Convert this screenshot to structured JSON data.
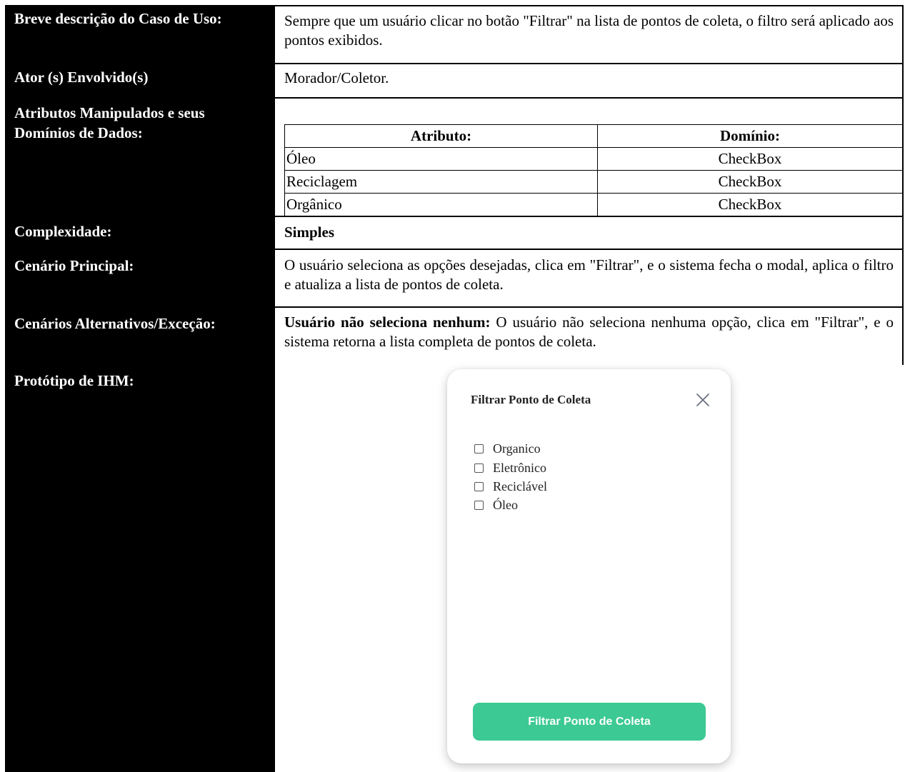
{
  "labels": {
    "description": "Breve descrição do Caso de Uso:",
    "actors": "Ator (s) Envolvido(s)",
    "attributes": "Atributos Manipulados e seus Domínios de Dados:",
    "complexity": "Complexidade:",
    "main_scenario": "Cenário Principal:",
    "alt_scenarios": "Cenários Alternativos/Exceção:",
    "prototype": "Protótipo de IHM:"
  },
  "values": {
    "description": "Sempre que um usuário clicar no botão \"Filtrar\" na lista de pontos de coleta, o filtro será aplicado aos pontos exibidos.",
    "actors": "Morador/Coletor.",
    "complexity": "Simples",
    "main_scenario": "O usuário seleciona as opções desejadas, clica em \"Filtrar\", e o sistema fecha o modal, aplica o filtro e atualiza a lista de pontos de coleta.",
    "alt_scenario_title": "Usuário não seleciona nenhum:",
    "alt_scenario_text": "O usuário não seleciona nenhuma opção, clica em \"Filtrar\", e o sistema retorna a lista completa de pontos de coleta."
  },
  "attribute_table": {
    "headers": [
      "Atributo:",
      "Domínio:"
    ],
    "rows": [
      [
        "Óleo",
        "CheckBox"
      ],
      [
        "Reciclagem",
        "CheckBox"
      ],
      [
        "Orgânico",
        "CheckBox"
      ]
    ]
  },
  "modal": {
    "title": "Filtrar Ponto de Coleta",
    "options": [
      "Organico",
      "Eletrônico",
      "Reciclável",
      "Óleo"
    ],
    "button_label": "Filtrar Ponto de Coleta",
    "accent_color": "#3cc993"
  }
}
